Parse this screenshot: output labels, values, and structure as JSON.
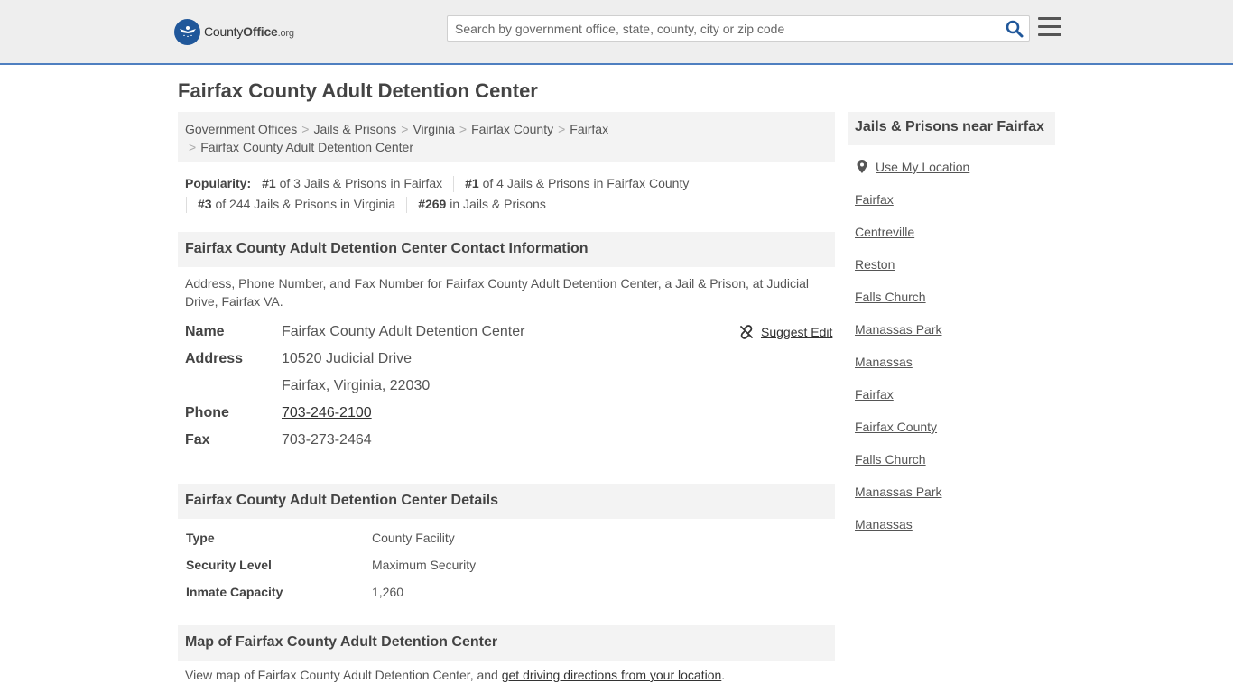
{
  "header": {
    "logo_county": "County",
    "logo_office": "Office",
    "logo_org": ".org",
    "search_placeholder": "Search by government office, state, county, city or zip code"
  },
  "page_title": "Fairfax County Adult Detention Center",
  "breadcrumb": {
    "items": [
      "Government Offices",
      "Jails & Prisons",
      "Virginia",
      "Fairfax County",
      "Fairfax"
    ],
    "current": "Fairfax County Adult Detention Center",
    "separator": ">"
  },
  "popularity": {
    "label": "Popularity:",
    "items": [
      {
        "rank": "#1",
        "text": " of 3 Jails & Prisons in Fairfax"
      },
      {
        "rank": "#1",
        "text": " of 4 Jails & Prisons in Fairfax County"
      },
      {
        "rank": "#3",
        "text": " of 244 Jails & Prisons in Virginia"
      },
      {
        "rank": "#269",
        "text": " in Jails & Prisons"
      }
    ]
  },
  "contact": {
    "heading": "Fairfax County Adult Detention Center Contact Information",
    "description": "Address, Phone Number, and Fax Number for Fairfax County Adult Detention Center, a Jail & Prison, at Judicial Drive, Fairfax VA.",
    "suggest_edit": "Suggest Edit",
    "name_label": "Name",
    "name_value": "Fairfax County Adult Detention Center",
    "address_label": "Address",
    "address_line1": "10520 Judicial Drive",
    "address_line2": "Fairfax, Virginia, 22030",
    "phone_label": "Phone",
    "phone_value": "703-246-2100",
    "fax_label": "Fax",
    "fax_value": "703-273-2464"
  },
  "details": {
    "heading": "Fairfax County Adult Detention Center Details",
    "rows": [
      {
        "label": "Type",
        "value": "County Facility"
      },
      {
        "label": "Security Level",
        "value": "Maximum Security"
      },
      {
        "label": "Inmate Capacity",
        "value": "1,260"
      }
    ]
  },
  "map": {
    "heading": "Map of Fairfax County Adult Detention Center",
    "text_before": "View map of Fairfax County Adult Detention Center, and ",
    "link": "get driving directions from your location",
    "text_after": "."
  },
  "sidebar": {
    "heading": "Jails & Prisons near Fairfax",
    "use_location": "Use My Location",
    "links": [
      "Fairfax",
      "Centreville",
      "Reston",
      "Falls Church",
      "Manassas Park",
      "Manassas",
      "Fairfax",
      "Fairfax County",
      "Falls Church",
      "Manassas Park",
      "Manassas"
    ]
  },
  "colors": {
    "brand_blue": "#20579a",
    "header_bg": "#eeeeee",
    "header_border": "#4f7fc0",
    "panel_bg": "#f3f3f3"
  }
}
